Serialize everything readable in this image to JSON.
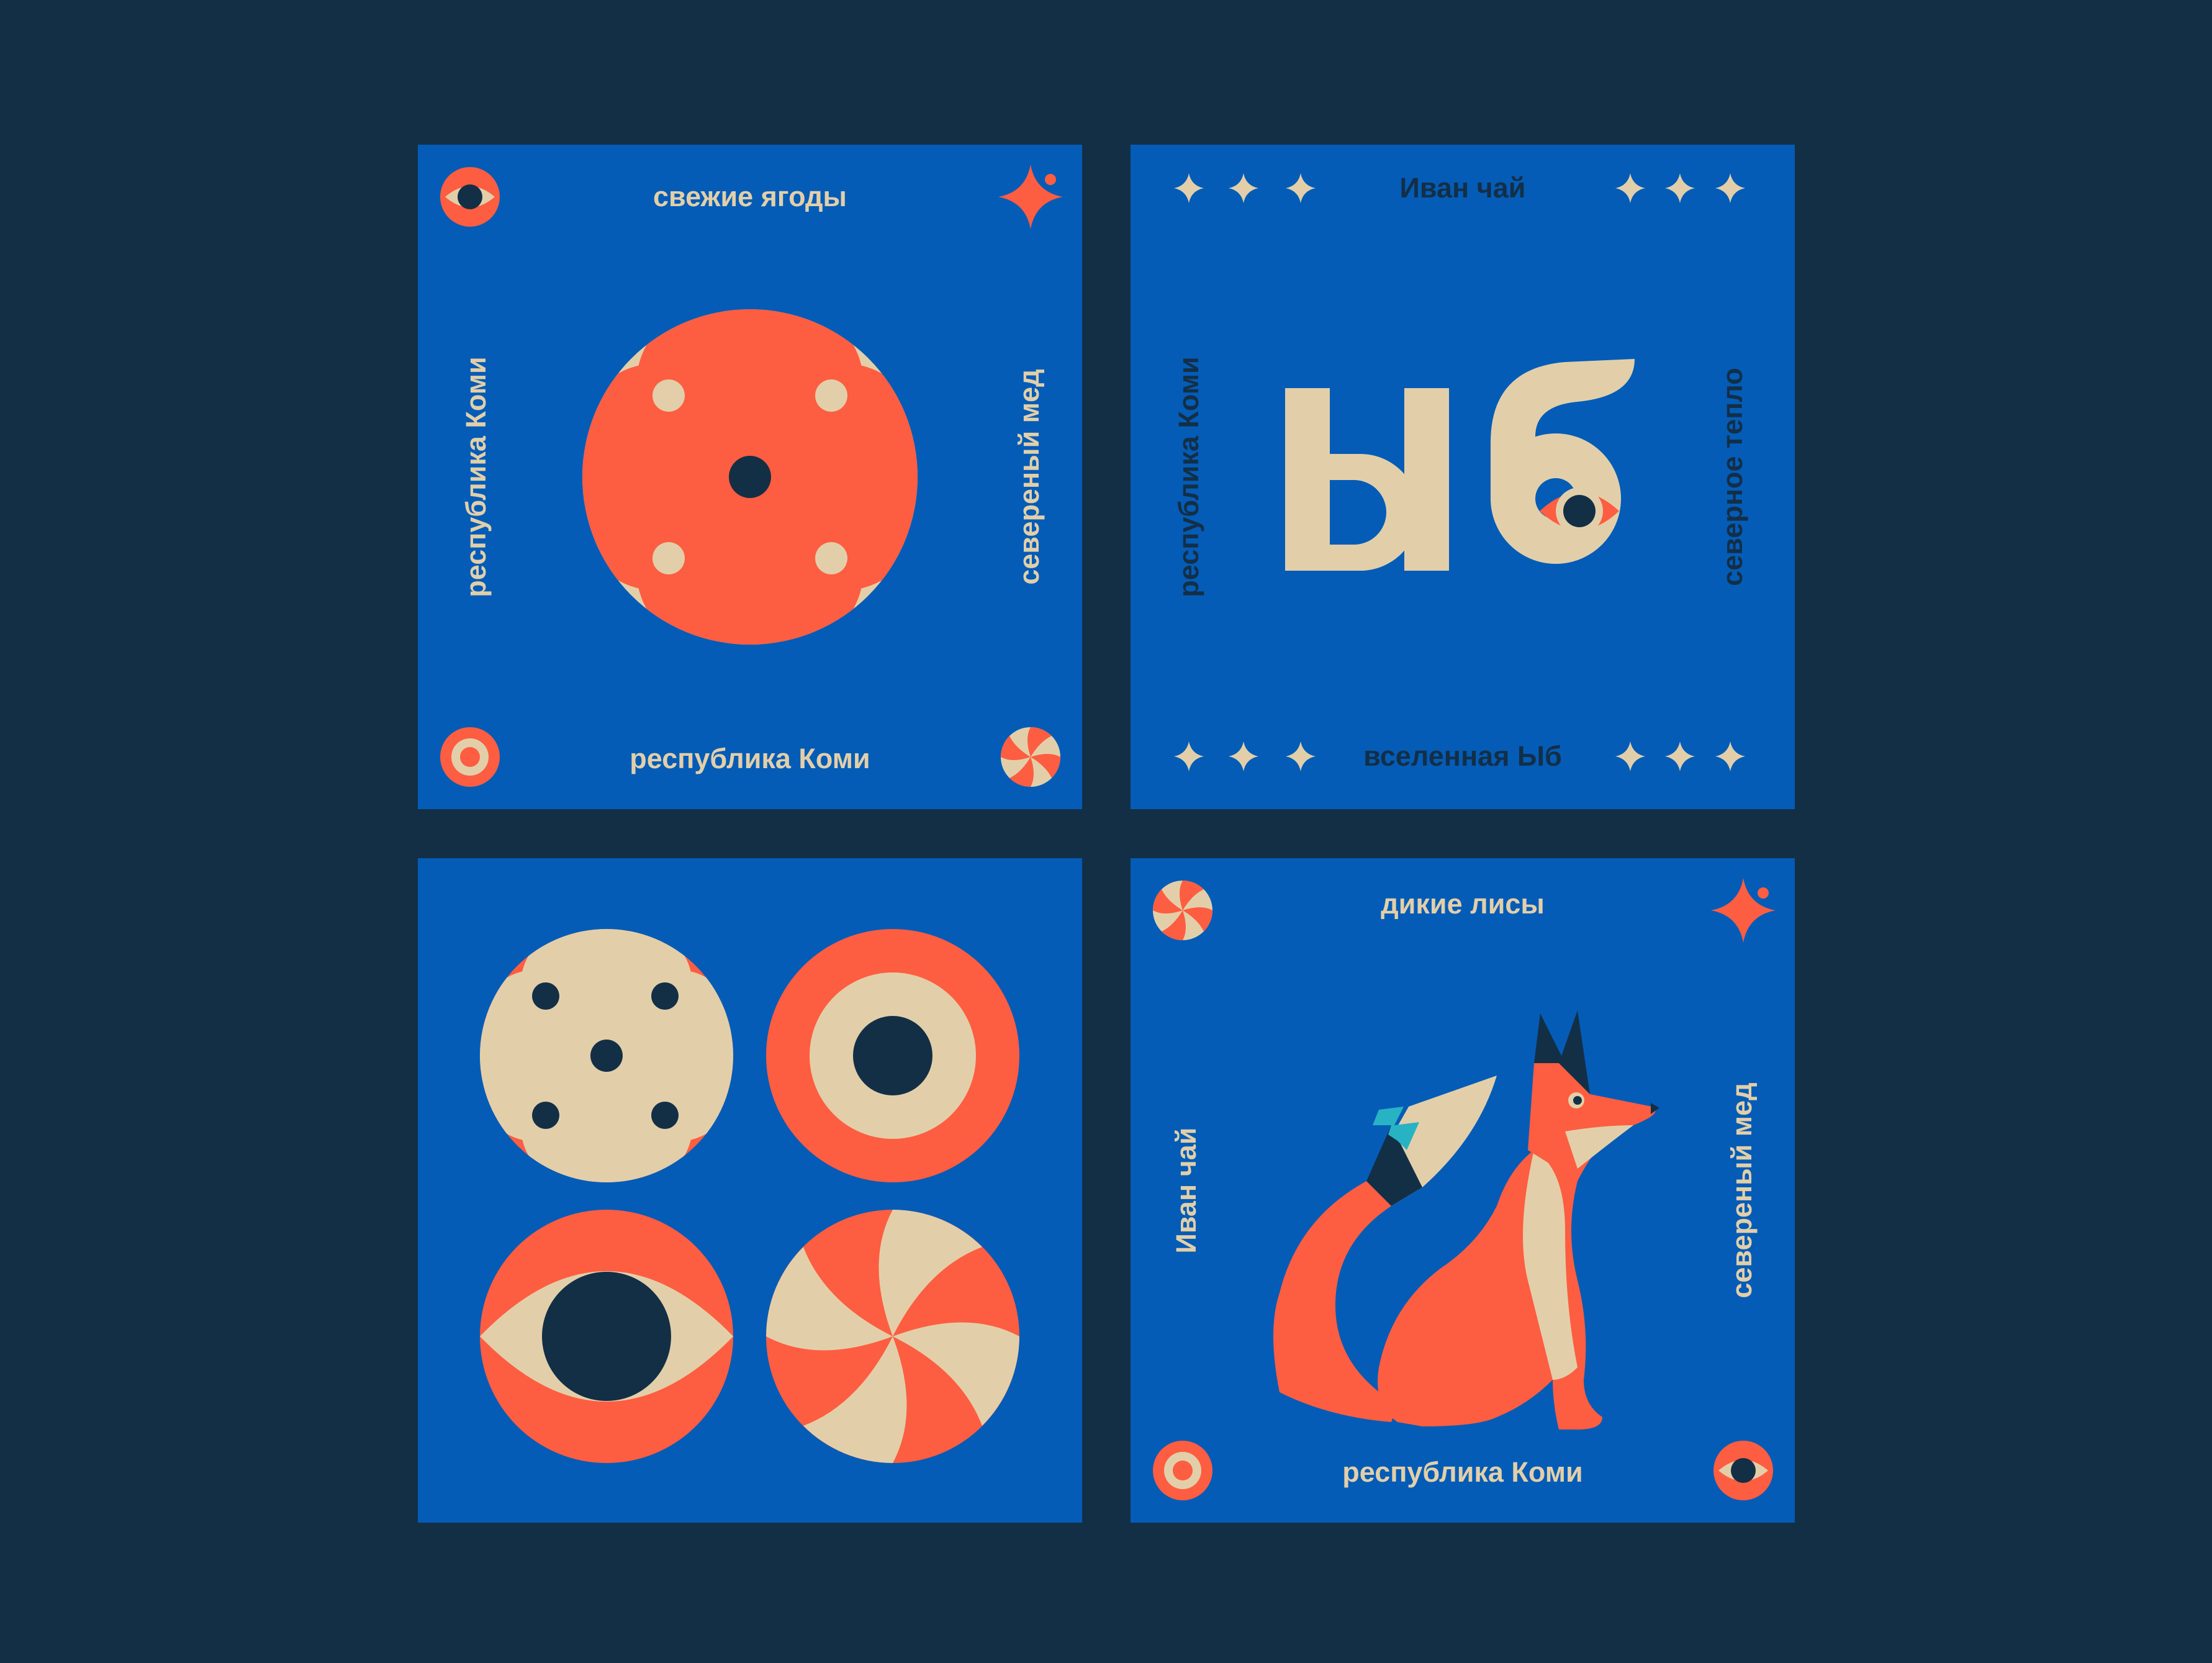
{
  "palette": {
    "background": "#132f46",
    "card_blue": "#045cb7",
    "cream": "#e2cfa9",
    "coral": "#fd5d40",
    "navy": "#132f46",
    "teal": "#27b3c4"
  },
  "cards": [
    {
      "id": "berries",
      "top": "свежие ягоды",
      "bottom": "республика Коми",
      "left": "республика Коми",
      "right": "северeный мед",
      "icons": [
        "eye-icon",
        "sparkle-icon",
        "target-icon",
        "swirl-icon"
      ],
      "center": "flower-medallion"
    },
    {
      "id": "yb-letters",
      "top": "Иван чай",
      "bottom": "вселенная Ыб",
      "left": "республика Коми",
      "right": "северное тепло",
      "big_word": "Ыб",
      "icons": [
        "star-icon",
        "eye-icon"
      ]
    },
    {
      "id": "pattern-grid",
      "icons": [
        "flower-medallion",
        "target-medallion",
        "eye-medallion",
        "swirl-medallion"
      ]
    },
    {
      "id": "fox",
      "top": "дикие лисы",
      "bottom": "республика Коми",
      "left": "Иван чай",
      "right": "северeный мед",
      "icons": [
        "swirl-icon",
        "sparkle-icon",
        "target-icon",
        "eye-icon"
      ],
      "center": "fox-illustration"
    }
  ]
}
